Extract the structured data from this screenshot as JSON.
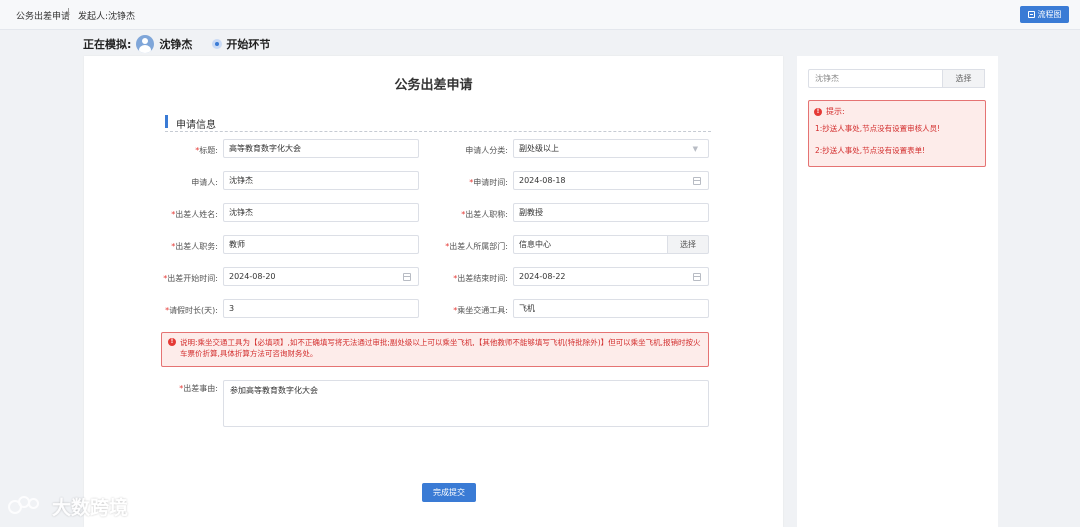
{
  "header": {
    "crumb_title": "公务出差申请",
    "crumb_initiator": "发起人:沈铮杰",
    "flow_button": "流程图"
  },
  "simulation": {
    "label": "正在模拟:",
    "user": "沈铮杰",
    "node": "开始环节"
  },
  "form": {
    "title": "公务出差申请",
    "section": "申请信息",
    "fields": {
      "title": {
        "label": "标题:",
        "value": "高等教育数字化大会"
      },
      "category": {
        "label": "申请人分类:",
        "value": "副处级以上"
      },
      "applicant": {
        "label": "申请人:",
        "value": "沈铮杰"
      },
      "apply_time": {
        "label": "申请时间:",
        "value": "2024-08-18"
      },
      "traveler_name": {
        "label": "出差人姓名:",
        "value": "沈铮杰"
      },
      "traveler_title": {
        "label": "出差人职称:",
        "value": "副教授"
      },
      "traveler_position": {
        "label": "出差人职务:",
        "value": "教师"
      },
      "traveler_dept": {
        "label": "出差人所属部门:",
        "value": "信息中心",
        "button": "选择"
      },
      "start_time": {
        "label": "出差开始时间:",
        "value": "2024-08-20"
      },
      "end_time": {
        "label": "出差结束时间:",
        "value": "2024-08-22"
      },
      "leave_days": {
        "label": "请假时长(天):",
        "value": "3"
      },
      "transport": {
        "label": "乘坐交通工具:",
        "value": "飞机"
      },
      "reason": {
        "label": "出差事由:",
        "value": "参加高等教育数字化大会"
      }
    },
    "note": "说明:乘坐交通工具为【必填项】,如不正确填写将无法通过审批;副处级以上可以乘坐飞机,【其他教师不能够填写飞机(特批除外)】但可以乘坐飞机,报销时按火车票价折算,具体折算方法可咨询财务处。",
    "submit": "完成提交"
  },
  "sidebar": {
    "input_value": "沈铮杰",
    "select_button": "选择",
    "tips_title": "提示:",
    "tips": [
      "1:抄送人事处,节点没有设置审核人员!",
      "2:抄送人事处,节点没有设置表单!"
    ]
  },
  "watermark": "大数跨境",
  "colors": {
    "primary": "#3a7bd5",
    "error": "#d32f2f",
    "error_bg": "#fdecea"
  }
}
